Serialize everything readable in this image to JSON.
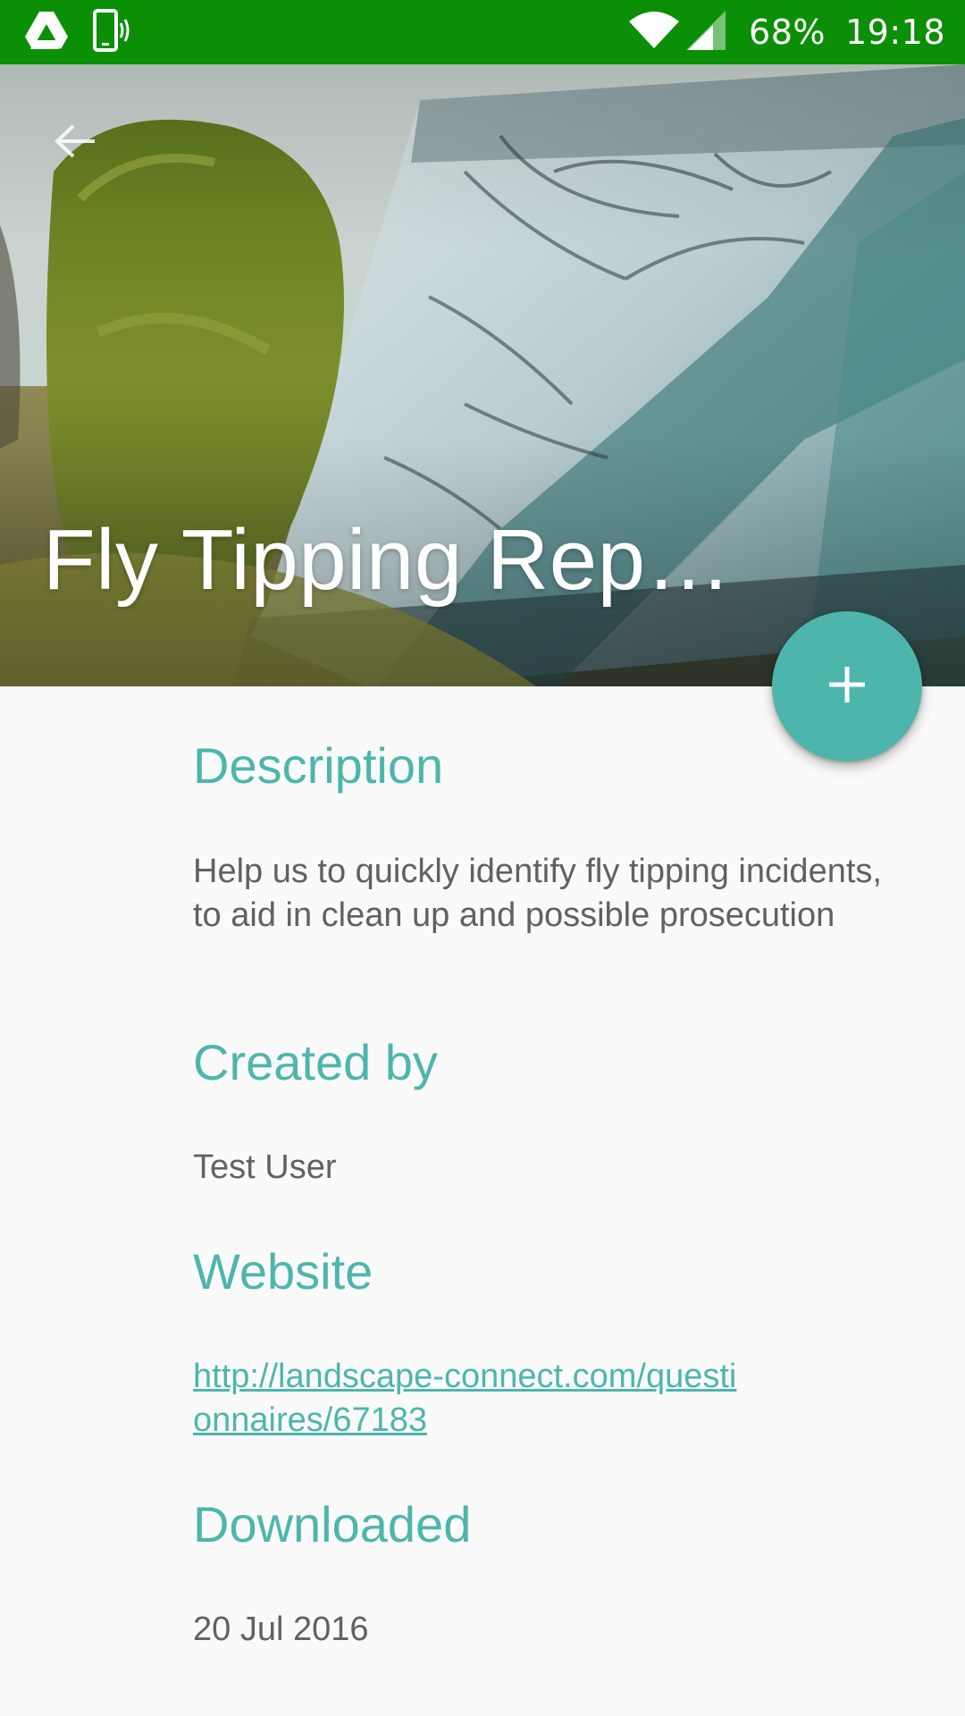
{
  "status_bar": {
    "battery": "68%",
    "time": "19:18",
    "icons": [
      "drive-icon",
      "vibrate-phone-icon",
      "wifi-icon",
      "signal-icon"
    ],
    "background": "#0a8f06"
  },
  "header": {
    "title": "Fly Tipping Rep…",
    "back_icon": "arrow-back-icon"
  },
  "fab": {
    "icon": "plus-icon",
    "color": "#4db6ac"
  },
  "sections": {
    "description": {
      "heading": "Description",
      "text": "Help us to quickly identify fly tipping incidents, to aid in clean up and possible prosecution"
    },
    "created_by": {
      "heading": "Created by",
      "text": "Test User"
    },
    "website": {
      "heading": "Website",
      "link": "http://landscape-connect.com/questionnaires/67183"
    },
    "downloaded": {
      "heading": "Downloaded",
      "text": "20 Jul 2016"
    }
  },
  "colors": {
    "accent": "#4db6ac",
    "body_text": "#616161",
    "background": "#fafafa"
  }
}
